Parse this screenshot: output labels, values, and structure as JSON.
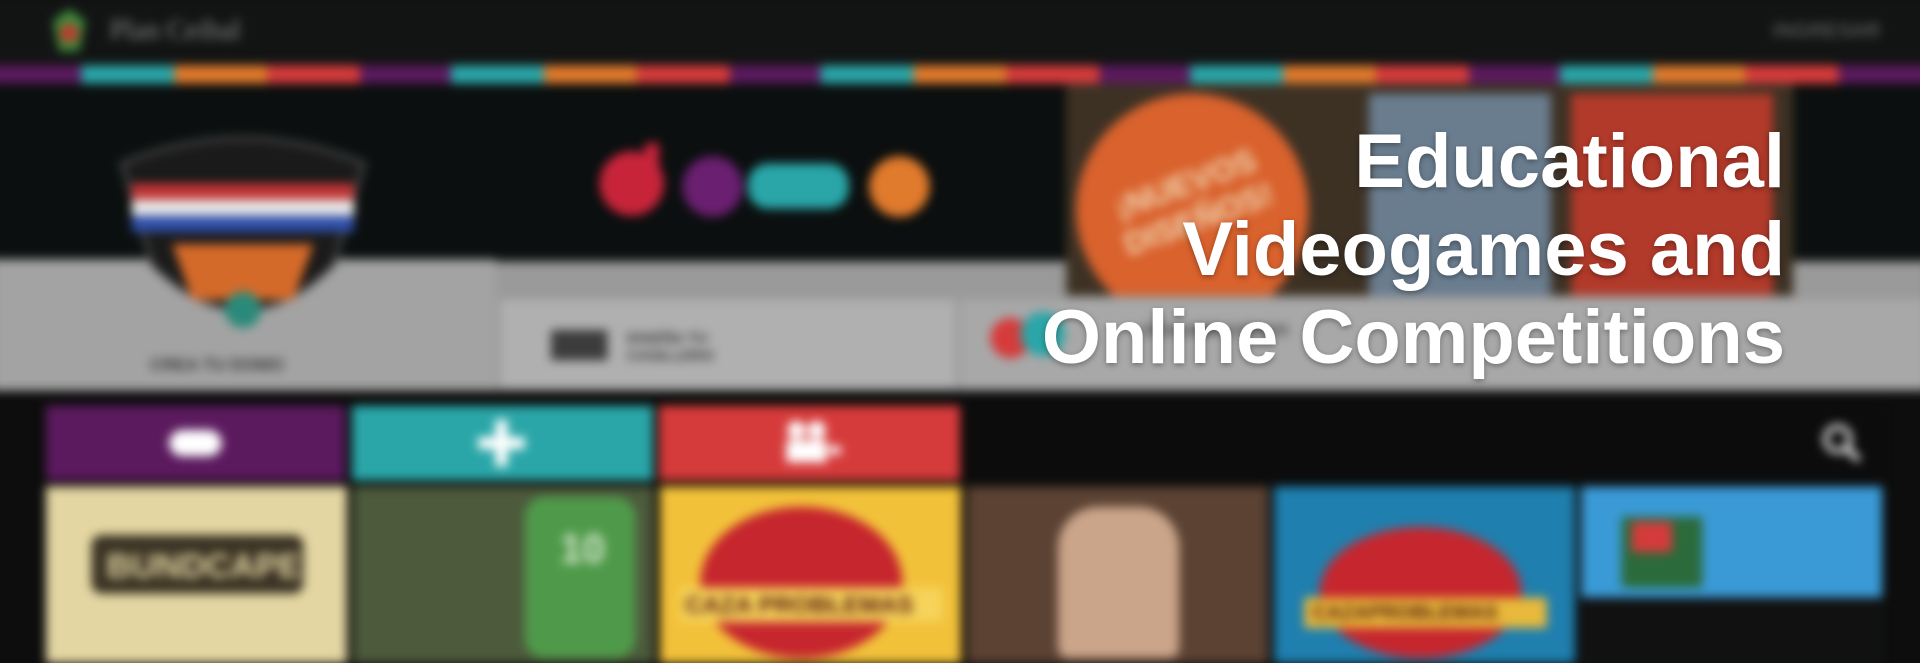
{
  "app": {
    "logo_text": "Plan Ceibal",
    "login_label": "INGRESAR"
  },
  "colors": {
    "purple": "#5b1a5e",
    "teal": "#2aa6a8",
    "orange": "#e07a2c",
    "red": "#d63b3b",
    "dark": "#0c0c0c",
    "title_text": "#ffffff"
  },
  "nav_tabs": [
    {
      "label": "CREA TU DOMO"
    },
    {
      "label": "DISEÑA TU CASILLERO"
    },
    {
      "label": "DESCUBRÍ JUEGOS"
    }
  ],
  "promo": {
    "burst_text": "¡NUEVOS DISEÑOS!"
  },
  "categories": [
    {
      "icon": "gamepad-icon",
      "color": "#5b1a5e"
    },
    {
      "icon": "plus-icon",
      "color": "#2aa6a8"
    },
    {
      "icon": "video-camera-icon",
      "color": "#d63b3b"
    }
  ],
  "search": {
    "icon": "search-icon"
  },
  "tiles": [
    {
      "label": "BUNDCAPE",
      "bg": "#e3d6a2"
    },
    {
      "label": "10",
      "bg": "#4d5a3c"
    },
    {
      "label": "CAZA PROBLEMAS",
      "bg": "#f2c13a"
    },
    {
      "label": "",
      "bg": "#5b4233"
    },
    {
      "label": "CAZAPROBLEMAS",
      "bg": "#1f7fae"
    },
    {
      "label": "",
      "bg": "#3a9ad6"
    }
  ],
  "overlay": {
    "title_line1": "Educational",
    "title_line2": "Videogames and",
    "title_line3": "Online Competitions"
  }
}
